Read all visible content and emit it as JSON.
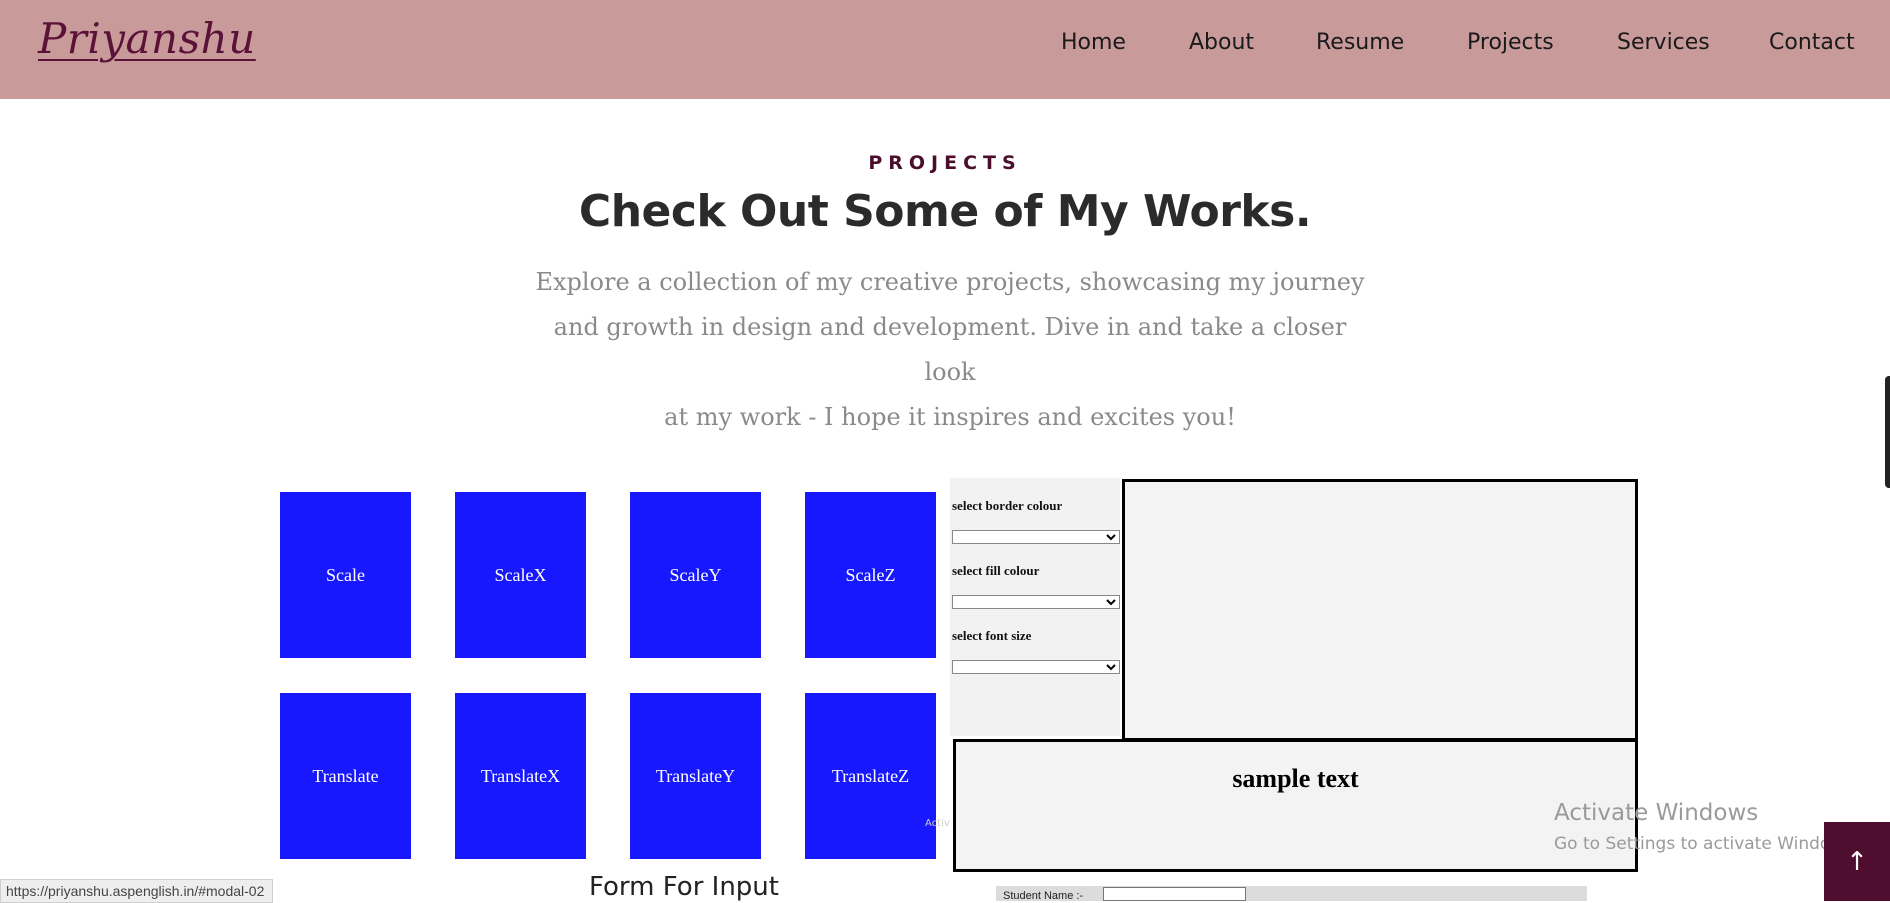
{
  "header": {
    "logo": "Priyanshu",
    "nav": [
      "Home",
      "About",
      "Resume",
      "Projects",
      "Services",
      "Contact"
    ]
  },
  "section": {
    "eyebrow": "PROJECTS",
    "title": "Check Out Some of My Works.",
    "intro_lines": [
      "Explore a collection of my creative projects, showcasing my journey",
      "and growth in design and development. Dive in and take a closer look",
      "at my work - I hope it inspires and excites you!"
    ]
  },
  "transform_boxes": {
    "row1": [
      "Scale",
      "ScaleX",
      "ScaleY",
      "ScaleZ"
    ],
    "row2": [
      "Translate",
      "TranslateX",
      "TranslateY",
      "TranslateZ"
    ],
    "color": "#1818ff"
  },
  "controls": {
    "border_label": "select border colour",
    "fill_label": "select fill colour",
    "font_label": "select font size",
    "border_value": "",
    "fill_value": "",
    "font_value": ""
  },
  "sample": {
    "text": "sample text"
  },
  "form": {
    "title": "Form For Input",
    "student_label": "Student Name :-",
    "student_value": ""
  },
  "watermark": {
    "line1": "Activate Windows",
    "line2": "Go to Settings to activate Windows."
  },
  "scroll_top_icon": "arrow-up-icon",
  "status_bar": {
    "url": "https://priyanshu.aspenglish.in/#modal-02"
  },
  "colors": {
    "header_bg": "#c99a9a",
    "logo": "#5b1238",
    "accent": "#4f0e30",
    "box_blue": "#1818ff"
  }
}
